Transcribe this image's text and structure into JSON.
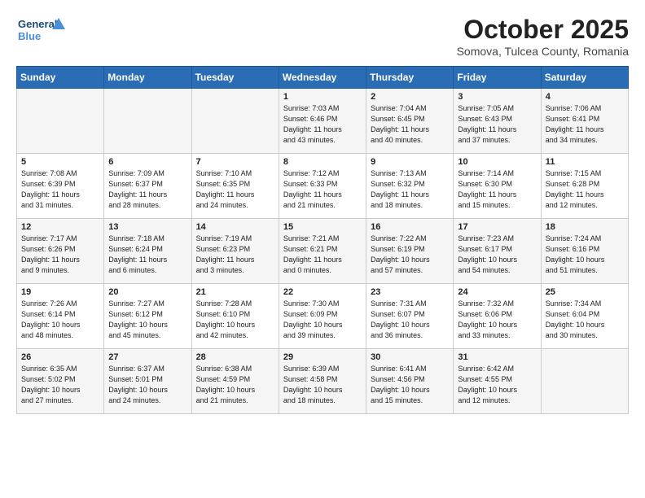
{
  "logo": {
    "line1": "General",
    "line2": "Blue"
  },
  "title": "October 2025",
  "subtitle": "Somova, Tulcea County, Romania",
  "days_header": [
    "Sunday",
    "Monday",
    "Tuesday",
    "Wednesday",
    "Thursday",
    "Friday",
    "Saturday"
  ],
  "weeks": [
    [
      {
        "day": "",
        "info": ""
      },
      {
        "day": "",
        "info": ""
      },
      {
        "day": "",
        "info": ""
      },
      {
        "day": "1",
        "info": "Sunrise: 7:03 AM\nSunset: 6:46 PM\nDaylight: 11 hours\nand 43 minutes."
      },
      {
        "day": "2",
        "info": "Sunrise: 7:04 AM\nSunset: 6:45 PM\nDaylight: 11 hours\nand 40 minutes."
      },
      {
        "day": "3",
        "info": "Sunrise: 7:05 AM\nSunset: 6:43 PM\nDaylight: 11 hours\nand 37 minutes."
      },
      {
        "day": "4",
        "info": "Sunrise: 7:06 AM\nSunset: 6:41 PM\nDaylight: 11 hours\nand 34 minutes."
      }
    ],
    [
      {
        "day": "5",
        "info": "Sunrise: 7:08 AM\nSunset: 6:39 PM\nDaylight: 11 hours\nand 31 minutes."
      },
      {
        "day": "6",
        "info": "Sunrise: 7:09 AM\nSunset: 6:37 PM\nDaylight: 11 hours\nand 28 minutes."
      },
      {
        "day": "7",
        "info": "Sunrise: 7:10 AM\nSunset: 6:35 PM\nDaylight: 11 hours\nand 24 minutes."
      },
      {
        "day": "8",
        "info": "Sunrise: 7:12 AM\nSunset: 6:33 PM\nDaylight: 11 hours\nand 21 minutes."
      },
      {
        "day": "9",
        "info": "Sunrise: 7:13 AM\nSunset: 6:32 PM\nDaylight: 11 hours\nand 18 minutes."
      },
      {
        "day": "10",
        "info": "Sunrise: 7:14 AM\nSunset: 6:30 PM\nDaylight: 11 hours\nand 15 minutes."
      },
      {
        "day": "11",
        "info": "Sunrise: 7:15 AM\nSunset: 6:28 PM\nDaylight: 11 hours\nand 12 minutes."
      }
    ],
    [
      {
        "day": "12",
        "info": "Sunrise: 7:17 AM\nSunset: 6:26 PM\nDaylight: 11 hours\nand 9 minutes."
      },
      {
        "day": "13",
        "info": "Sunrise: 7:18 AM\nSunset: 6:24 PM\nDaylight: 11 hours\nand 6 minutes."
      },
      {
        "day": "14",
        "info": "Sunrise: 7:19 AM\nSunset: 6:23 PM\nDaylight: 11 hours\nand 3 minutes."
      },
      {
        "day": "15",
        "info": "Sunrise: 7:21 AM\nSunset: 6:21 PM\nDaylight: 11 hours\nand 0 minutes."
      },
      {
        "day": "16",
        "info": "Sunrise: 7:22 AM\nSunset: 6:19 PM\nDaylight: 10 hours\nand 57 minutes."
      },
      {
        "day": "17",
        "info": "Sunrise: 7:23 AM\nSunset: 6:17 PM\nDaylight: 10 hours\nand 54 minutes."
      },
      {
        "day": "18",
        "info": "Sunrise: 7:24 AM\nSunset: 6:16 PM\nDaylight: 10 hours\nand 51 minutes."
      }
    ],
    [
      {
        "day": "19",
        "info": "Sunrise: 7:26 AM\nSunset: 6:14 PM\nDaylight: 10 hours\nand 48 minutes."
      },
      {
        "day": "20",
        "info": "Sunrise: 7:27 AM\nSunset: 6:12 PM\nDaylight: 10 hours\nand 45 minutes."
      },
      {
        "day": "21",
        "info": "Sunrise: 7:28 AM\nSunset: 6:10 PM\nDaylight: 10 hours\nand 42 minutes."
      },
      {
        "day": "22",
        "info": "Sunrise: 7:30 AM\nSunset: 6:09 PM\nDaylight: 10 hours\nand 39 minutes."
      },
      {
        "day": "23",
        "info": "Sunrise: 7:31 AM\nSunset: 6:07 PM\nDaylight: 10 hours\nand 36 minutes."
      },
      {
        "day": "24",
        "info": "Sunrise: 7:32 AM\nSunset: 6:06 PM\nDaylight: 10 hours\nand 33 minutes."
      },
      {
        "day": "25",
        "info": "Sunrise: 7:34 AM\nSunset: 6:04 PM\nDaylight: 10 hours\nand 30 minutes."
      }
    ],
    [
      {
        "day": "26",
        "info": "Sunrise: 6:35 AM\nSunset: 5:02 PM\nDaylight: 10 hours\nand 27 minutes."
      },
      {
        "day": "27",
        "info": "Sunrise: 6:37 AM\nSunset: 5:01 PM\nDaylight: 10 hours\nand 24 minutes."
      },
      {
        "day": "28",
        "info": "Sunrise: 6:38 AM\nSunset: 4:59 PM\nDaylight: 10 hours\nand 21 minutes."
      },
      {
        "day": "29",
        "info": "Sunrise: 6:39 AM\nSunset: 4:58 PM\nDaylight: 10 hours\nand 18 minutes."
      },
      {
        "day": "30",
        "info": "Sunrise: 6:41 AM\nSunset: 4:56 PM\nDaylight: 10 hours\nand 15 minutes."
      },
      {
        "day": "31",
        "info": "Sunrise: 6:42 AM\nSunset: 4:55 PM\nDaylight: 10 hours\nand 12 minutes."
      },
      {
        "day": "",
        "info": ""
      }
    ]
  ]
}
